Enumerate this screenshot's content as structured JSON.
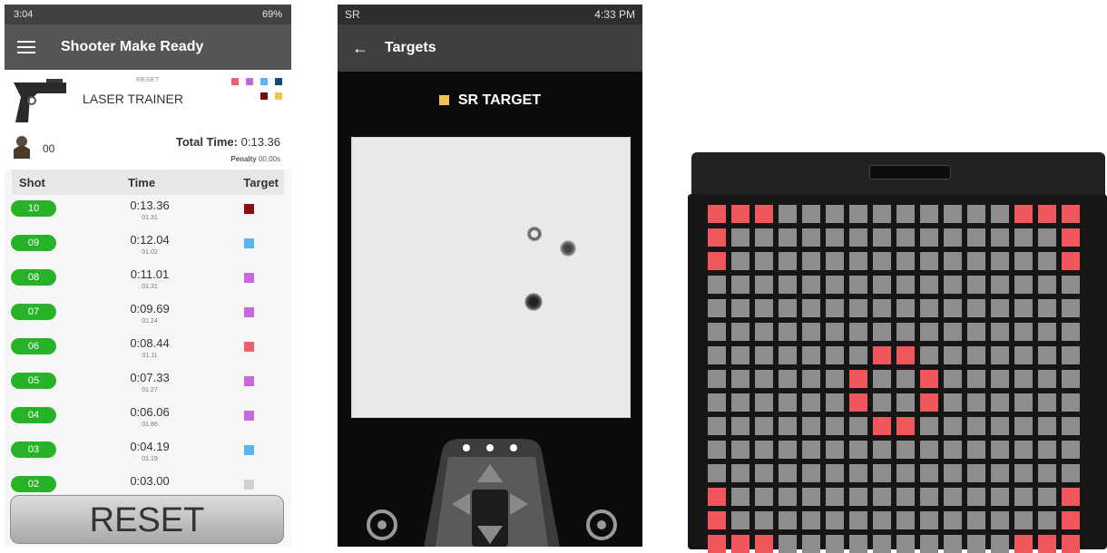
{
  "phone1": {
    "status": {
      "time": "3:04",
      "right": "69%"
    },
    "app_title": "Shooter Make Ready",
    "device": {
      "small_label": "RESET",
      "name": "LASER TRAINER",
      "swatches_row1": [
        "#f0606a",
        "#c866e0",
        "#5ab4ef",
        "#114a7a"
      ],
      "swatches_row2": [
        "#7a0b0b",
        "#f2c14e"
      ]
    },
    "user_count": "00",
    "total_time_label": "Total Time:",
    "total_time_value": "0:13.36",
    "penalty_label": "Penalty",
    "penalty_value": "00.00s",
    "columns": {
      "shot": "Shot",
      "time": "Time",
      "target": "Target"
    },
    "shots": [
      {
        "num": "10",
        "time": "0:13.36",
        "split": "01.31",
        "color": "#8b0f0f"
      },
      {
        "num": "09",
        "time": "0:12.04",
        "split": "01.02",
        "color": "#5ab4ef"
      },
      {
        "num": "08",
        "time": "0:11.01",
        "split": "01.31",
        "color": "#c866e0"
      },
      {
        "num": "07",
        "time": "0:09.69",
        "split": "01.24",
        "color": "#c866e0"
      },
      {
        "num": "06",
        "time": "0:08.44",
        "split": "01.11",
        "color": "#f0606a"
      },
      {
        "num": "05",
        "time": "0:07.33",
        "split": "01.27",
        "color": "#c866e0"
      },
      {
        "num": "04",
        "time": "0:06.06",
        "split": "01.86",
        "color": "#c866e0"
      },
      {
        "num": "03",
        "time": "0:04.19",
        "split": "01.19",
        "color": "#5ab4ef"
      },
      {
        "num": "02",
        "time": "0:03.00",
        "split": "",
        "color": "#d0d0d0"
      }
    ],
    "reset_button": "RESET"
  },
  "phone2": {
    "status": {
      "left": "SR",
      "time": "4:33 PM"
    },
    "title": "Targets",
    "target_label": "SR TARGET",
    "target_color": "#f2c14e"
  },
  "matrix": {
    "on_color": "#f0575c",
    "off_color": "#8d8d8d",
    "rows": [
      "1110000000000111",
      "1000000000000001",
      "1000000000000001",
      "0000000000000000",
      "0000000000000000",
      "0000000000000000",
      "0000000110000000",
      "0000001001000000",
      "0000001001000000",
      "0000000110000000",
      "0000000000000000",
      "0000000000000000",
      "1000000000000001",
      "1000000000000001",
      "1110000000000111"
    ]
  }
}
